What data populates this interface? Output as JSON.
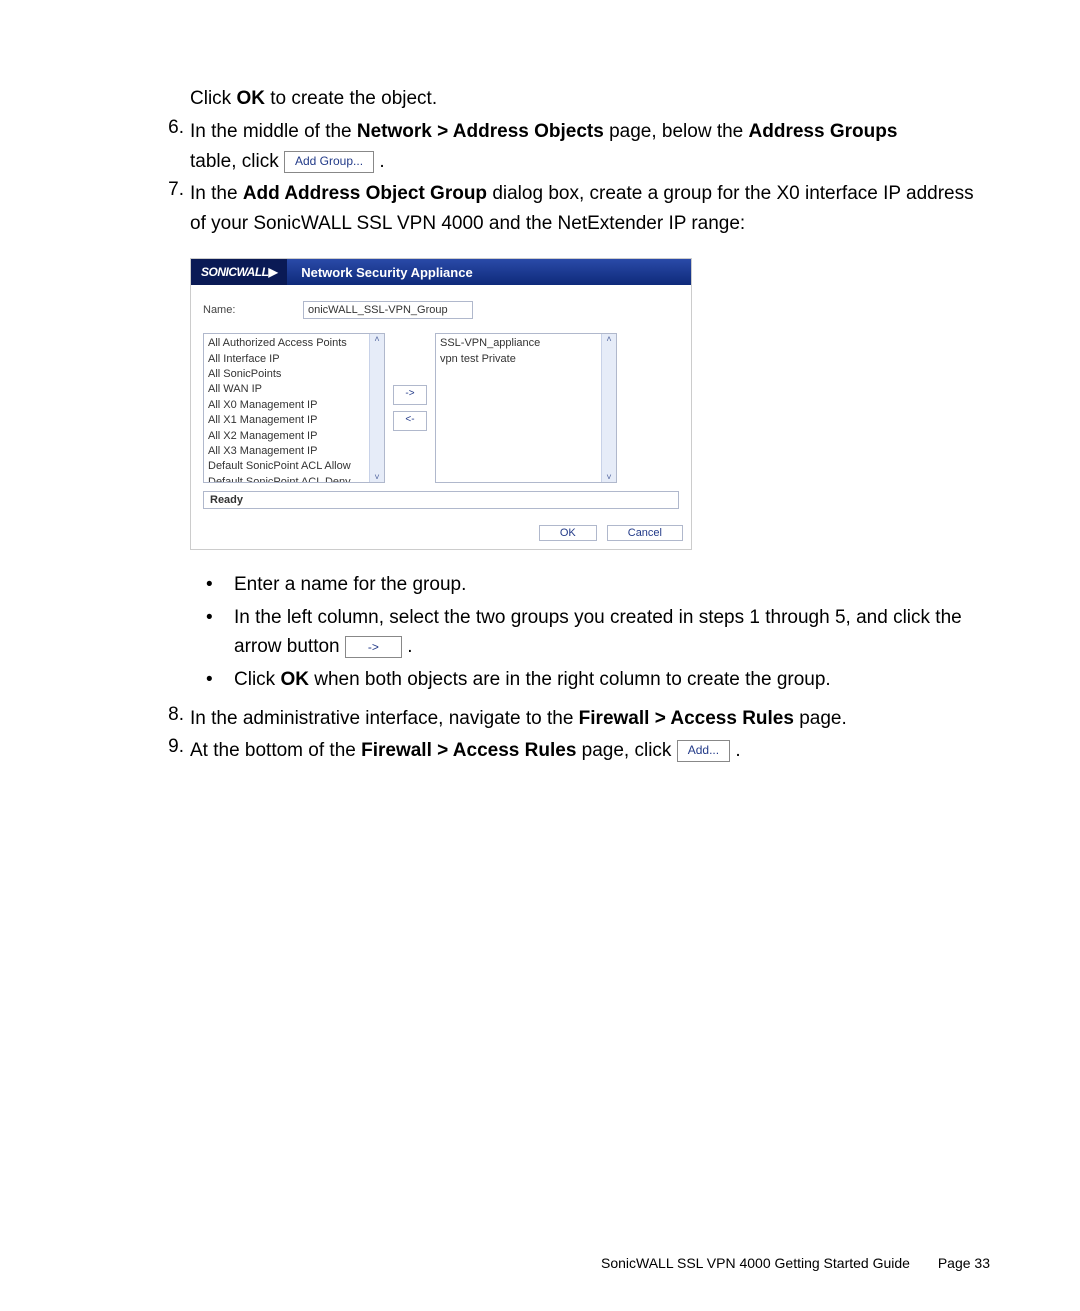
{
  "intro": {
    "pre": "Click ",
    "ok": "OK",
    "post": " to create the object."
  },
  "steps": {
    "s6": {
      "num": "6.",
      "t1": "In the middle of the ",
      "b1": "Network > Address Objects",
      "t2": " page, below the ",
      "b2": "Address Groups",
      "t3": "table, click ",
      "btn": "Add Group...",
      "t4": " ."
    },
    "s7": {
      "num": "7.",
      "t1": "In the ",
      "b1": "Add Address Object Group",
      "t2": " dialog box, create a group for the X0 interface IP address of your SonicWALL SSL VPN 4000 and the NetExtender IP range:"
    },
    "s8": {
      "num": "8.",
      "t1": "In the administrative interface, navigate to the ",
      "b1": "Firewall > Access Rules",
      "t2": " page."
    },
    "s9": {
      "num": "9.",
      "t1": "At the bottom of the ",
      "b1": "Firewall > Access Rules",
      "t2": " page, click ",
      "btn": "Add...",
      "t3": " ."
    }
  },
  "dialog": {
    "logo": "SONICWALL",
    "title": "Network Security Appliance",
    "nameLabel": "Name:",
    "nameValue": "onicWALL_SSL-VPN_Group",
    "leftList": [
      "All Authorized Access Points",
      "All Interface IP",
      "All SonicPoints",
      "All WAN IP",
      "All X0 Management IP",
      "All X1 Management IP",
      "All X2 Management IP",
      "All X3 Management IP",
      "Default SonicPoint ACL Allow",
      "Default SonicPoint ACL Deny"
    ],
    "rightList": [
      "SSL-VPN_appliance",
      "vpn test Private"
    ],
    "arrowRight": "->",
    "arrowLeft": "<-",
    "status": "Ready",
    "ok": "OK",
    "cancel": "Cancel"
  },
  "sub": {
    "b1": "Enter a name for the group.",
    "b2a": "In the left column, select the two groups you created in steps 1 through 5, and click the arrow button ",
    "b2btn": "->",
    "b2c": " .",
    "b3a": "Click ",
    "b3b": "OK",
    "b3c": " when both objects are in the right column to create the group."
  },
  "footer": {
    "title": "SonicWALL SSL VPN 4000 Getting Started Guide",
    "page": "Page 33"
  }
}
